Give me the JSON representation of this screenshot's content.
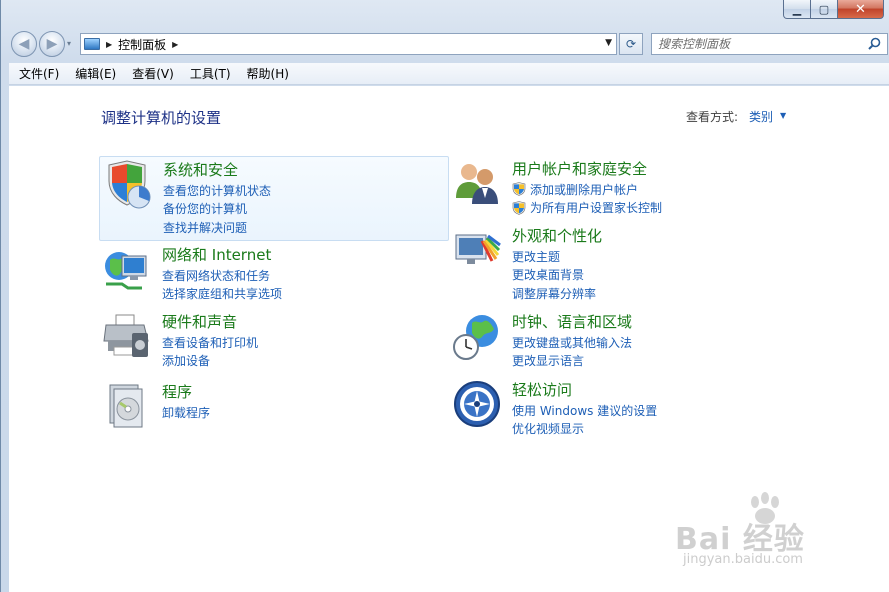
{
  "window": {
    "min_glyph": "▁",
    "max_glyph": "▢",
    "close_glyph": "✕"
  },
  "nav": {
    "back_glyph": "◀",
    "forward_glyph": "▶",
    "dropdown_glyph": "▾",
    "breadcrumb_arrow": "▶",
    "address": "控制面板",
    "address_trail_arrow": "▶",
    "address_dropdown_glyph": "▼",
    "refresh_glyph": "⟳",
    "search_placeholder": "搜索控制面板",
    "search_glyph": "⚲"
  },
  "menubar": {
    "items": [
      "文件(F)",
      "编辑(E)",
      "查看(V)",
      "工具(T)",
      "帮助(H)"
    ]
  },
  "main": {
    "title": "调整计算机的设置",
    "view_label": "查看方式:",
    "view_value": "类别",
    "view_caret": "▼"
  },
  "categories": [
    {
      "title": "系统和安全",
      "icon": "system-security-icon",
      "links": [
        "查看您的计算机状态",
        "备份您的计算机",
        "查找并解决问题"
      ]
    },
    {
      "title": "用户帐户和家庭安全",
      "icon": "user-accounts-icon",
      "links": [
        "添加或删除用户帐户",
        "为所有用户设置家长控制"
      ]
    },
    {
      "title": "网络和 Internet",
      "icon": "network-icon",
      "links": [
        "查看网络状态和任务",
        "选择家庭组和共享选项"
      ]
    },
    {
      "title": "外观和个性化",
      "icon": "appearance-icon",
      "links": [
        "更改主题",
        "更改桌面背景",
        "调整屏幕分辨率"
      ]
    },
    {
      "title": "硬件和声音",
      "icon": "hardware-sound-icon",
      "links": [
        "查看设备和打印机",
        "添加设备"
      ]
    },
    {
      "title": "时钟、语言和区域",
      "icon": "clock-language-icon",
      "links": [
        "更改键盘或其他输入法",
        "更改显示语言"
      ]
    },
    {
      "title": "程序",
      "icon": "programs-icon",
      "links": [
        "卸载程序"
      ]
    },
    {
      "title": "轻松访问",
      "icon": "ease-of-access-icon",
      "links": [
        "使用 Windows 建议的设置",
        "优化视频显示"
      ]
    }
  ],
  "watermark": {
    "main": "Bai 经验",
    "sub": "jingyan.baidu.com"
  }
}
